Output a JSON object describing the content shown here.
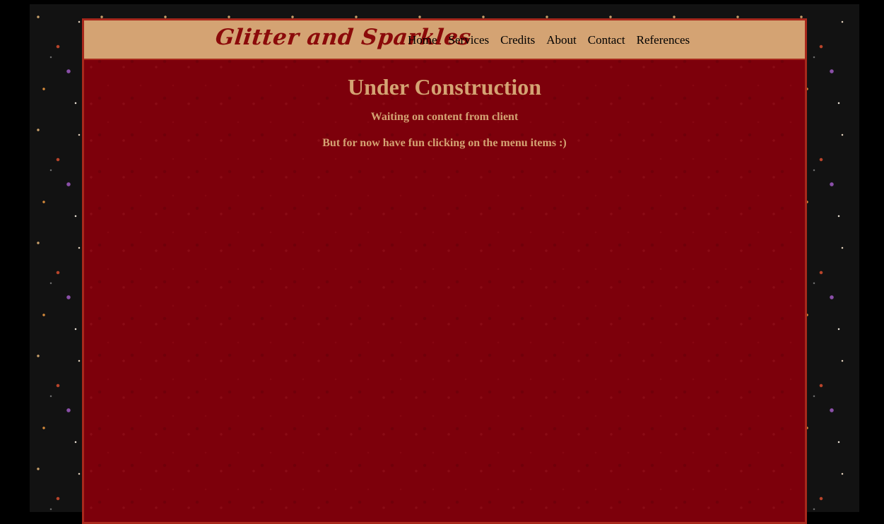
{
  "header": {
    "logo": "Glitter and Sparkles",
    "nav": [
      "Home",
      "Services",
      "Credits",
      "About",
      "Contact",
      "References"
    ]
  },
  "main": {
    "title": "Under Construction",
    "line1": "Waiting on content from client",
    "line2": "But for now have fun clicking on the menu items :)"
  },
  "colors": {
    "header_bg": "#d4a373",
    "content_bg": "#7d000b",
    "accent_text": "#d4a373",
    "logo_text": "#8b0a0a",
    "page_bg": "#121212"
  }
}
